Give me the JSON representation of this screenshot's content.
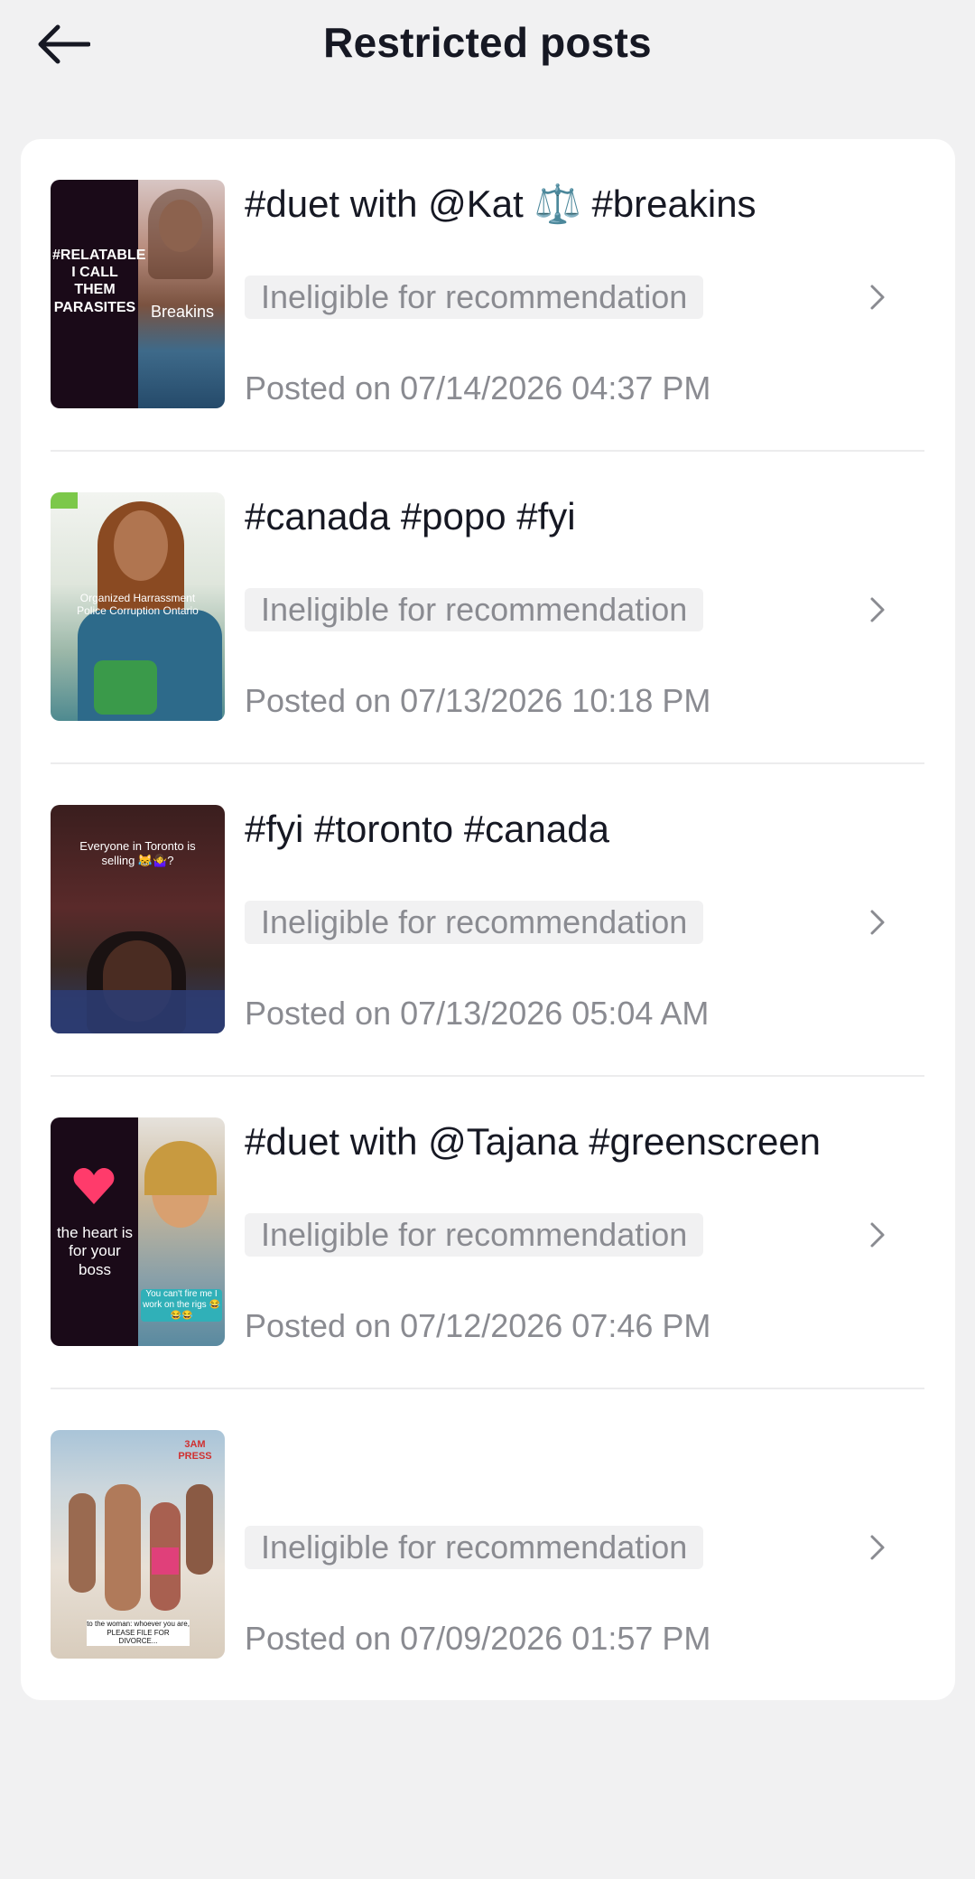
{
  "header": {
    "title": "Restricted posts"
  },
  "posts": [
    {
      "caption": "#duet with @Kat ⚖️ #breakins",
      "status": "Ineligible for recommendation",
      "date": "Posted on 07/14/2026 04:37 PM",
      "thumb_text_left": "#RELATABLE\nI CALL THEM\nPARASITES",
      "thumb_text_right": "Breakins"
    },
    {
      "caption": "#canada #popo #fyi",
      "status": "Ineligible for recommendation",
      "date": "Posted on 07/13/2026 10:18 PM",
      "thumb_text": "Organized Harrassment\nPolice Corruption Ontario"
    },
    {
      "caption": "#fyi #toronto #canada",
      "status": "Ineligible for recommendation",
      "date": "Posted on 07/13/2026 05:04 AM",
      "thumb_text": "Everyone in Toronto is\nselling 😹🤷‍♀️?"
    },
    {
      "caption": "#duet with @Tajana #greenscreen",
      "status": "Ineligible for recommendation",
      "date": "Posted on 07/12/2026 07:46 PM",
      "thumb_text_left": "the heart is\nfor your\nboss",
      "thumb_text_right": "You can't fire me I work on the rigs 😂😂😂"
    },
    {
      "caption": "",
      "status": "Ineligible for recommendation",
      "date": "Posted on 07/09/2026 01:57 PM",
      "thumb_text_top": "3AM PRESS",
      "thumb_text": "to the woman: whoever you are, PLEASE FILE FOR DIVORCE..."
    }
  ],
  "colors": {
    "background": "#f1f1f2",
    "card": "#ffffff",
    "badge_bg": "#f1f1f2",
    "muted_text": "#8a8b91",
    "primary_text": "#161823"
  },
  "icons": {
    "back": "arrow-left-icon",
    "row": "chevron-right-icon"
  }
}
